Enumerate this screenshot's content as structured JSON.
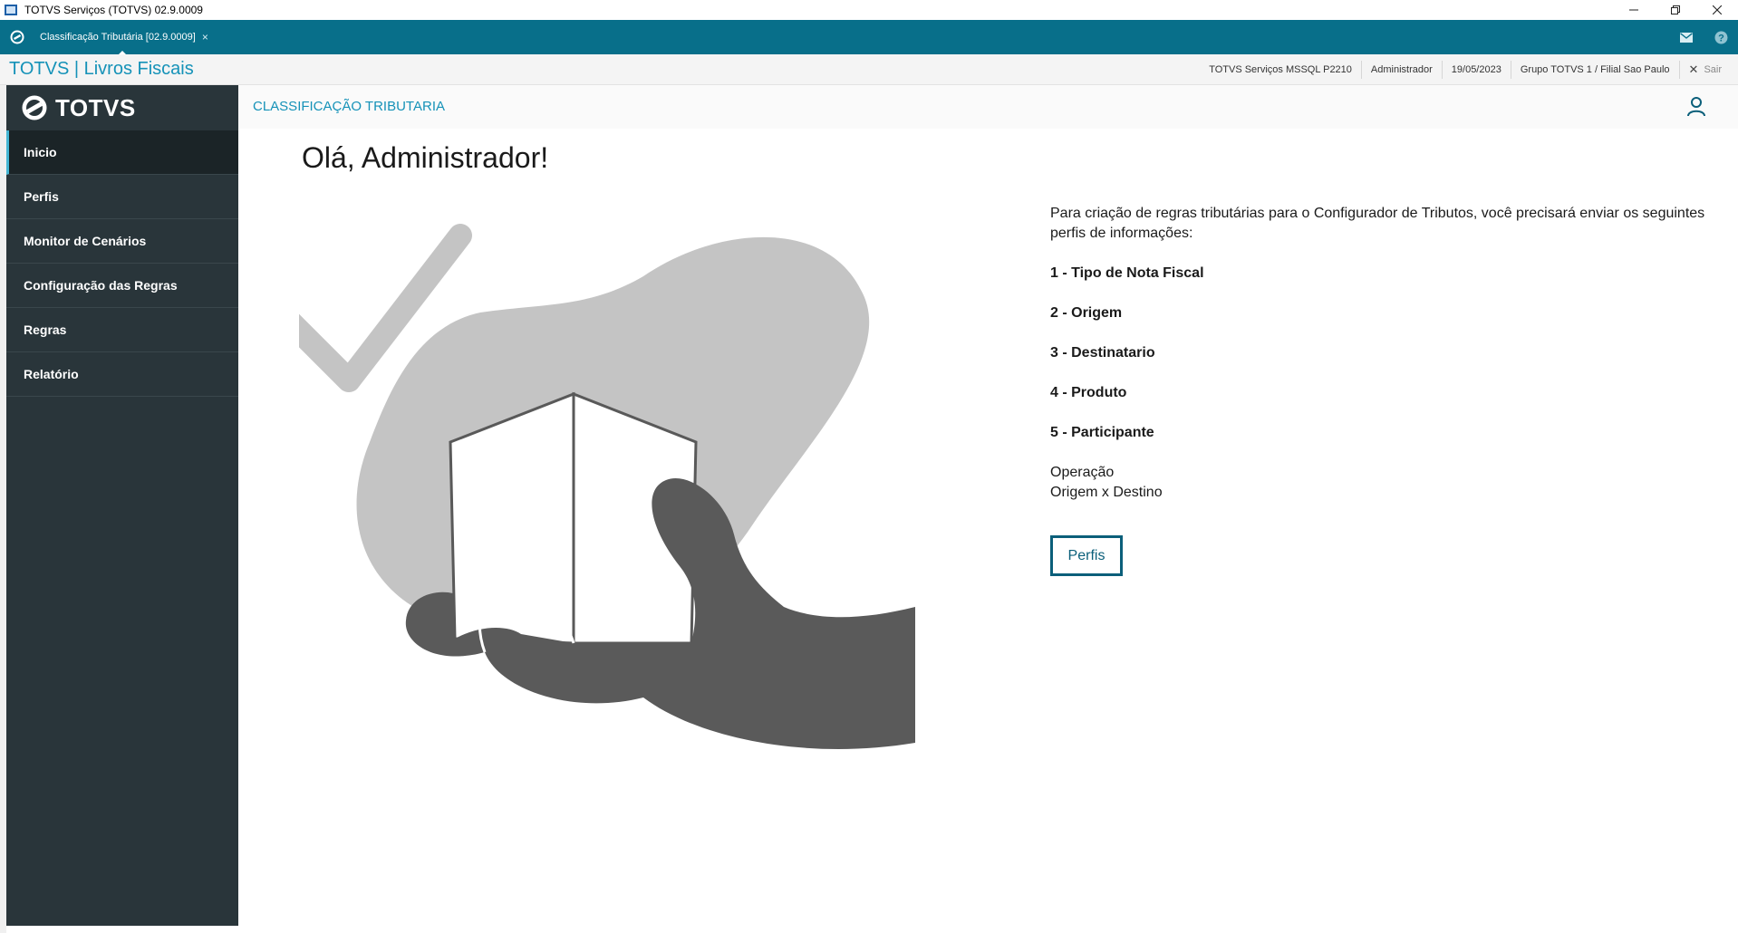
{
  "window": {
    "title": "TOTVS Serviços (TOTVS) 02.9.0009",
    "icon": "app-window-icon",
    "controls": [
      "minimize-icon",
      "restore-icon",
      "close-icon"
    ]
  },
  "tabbar": {
    "home_icon": "totvs-home-icon",
    "active_tab": {
      "label": "Classificação Tributária [02.9.0009]",
      "close": "×"
    },
    "right_icons": [
      "mail-icon",
      "help-icon"
    ],
    "color": "#086f8a"
  },
  "module": {
    "title": "TOTVS | Livros Fiscais",
    "environment": "TOTVS Serviços MSSQL P2210",
    "user": "Administrador",
    "date": "19/05/2023",
    "branch": "Grupo TOTVS 1 / Filial Sao Paulo",
    "exit_label": "Sair"
  },
  "sidebar": {
    "brand": "TOTVS",
    "items": [
      {
        "label": "Inicio",
        "active": true
      },
      {
        "label": "Perfis",
        "active": false
      },
      {
        "label": "Monitor de Cenários",
        "active": false
      },
      {
        "label": "Configuração das Regras",
        "active": false
      },
      {
        "label": "Regras",
        "active": false
      },
      {
        "label": "Relatório",
        "active": false
      }
    ]
  },
  "content": {
    "page_title": "CLASSIFICAÇÃO TRIBUTARIA",
    "greeting": "Olá, Administrador!",
    "intro": "Para criação de regras tributárias para o Configurador de Tributos, você precisará enviar os seguintes perfis de informações:",
    "steps": [
      "1 - Tipo de Nota Fiscal",
      "2 - Origem",
      "3 - Destinatario",
      "4 - Produto",
      "5 - Participante"
    ],
    "notes": [
      "Operação",
      "Origem x Destino"
    ],
    "button_label": "Perfis",
    "illustration": "hand-holding-box-checkmark-illustration"
  },
  "colors": {
    "accent": "#1592b8",
    "sidebar_bg": "#29353a",
    "button_border": "#0b5f7a"
  }
}
